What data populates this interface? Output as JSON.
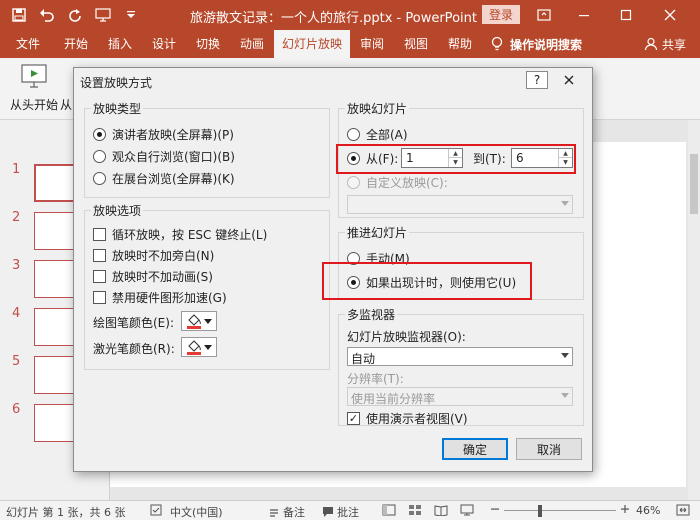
{
  "colors": {
    "accent": "#b7472a",
    "highlight": "#e0191c",
    "pen": "#e53935"
  },
  "window": {
    "title": "旅游散文记录：一个人的旅行.pptx  -  PowerPoint",
    "login": "登录"
  },
  "ribbon": {
    "tabs": [
      "文件",
      "开始",
      "插入",
      "设计",
      "切换",
      "动画",
      "幻灯片放映",
      "审阅",
      "视图",
      "帮助"
    ],
    "active_tab": "幻灯片放映",
    "tell_me": "操作说明搜索",
    "share": "共享",
    "from_beginning": "从头开始",
    "from_current": "从"
  },
  "thumbnails": [
    "1",
    "2",
    "3",
    "4",
    "5",
    "6"
  ],
  "dialog": {
    "title": "设置放映方式",
    "help": "?",
    "show_type": {
      "label": "放映类型",
      "options": [
        "演讲者放映(全屏幕)(P)",
        "观众自行浏览(窗口)(B)",
        "在展台浏览(全屏幕)(K)"
      ],
      "selected_index": 0
    },
    "show_options": {
      "label": "放映选项",
      "checks": [
        "循环放映，按 ESC 键终止(L)",
        "放映时不加旁白(N)",
        "放映时不加动画(S)",
        "禁用硬件图形加速(G)"
      ],
      "pen_color_label": "绘图笔颜色(E):",
      "laser_color_label": "激光笔颜色(R):"
    },
    "show_slides": {
      "label": "放映幻灯片",
      "all": "全部(A)",
      "from": "从(F):",
      "from_value": "1",
      "to": "到(T):",
      "to_value": "6",
      "custom": "自定义放映(C):"
    },
    "advance": {
      "label": "推进幻灯片",
      "manual": "手动(M)",
      "timings": "如果出现计时，则使用它(U)"
    },
    "monitors": {
      "label": "多监视器",
      "monitor_label": "幻灯片放映监视器(O):",
      "monitor_value": "自动",
      "resolution_label": "分辨率(T):",
      "resolution_value": "使用当前分辨率",
      "presenter_view": "使用演示者视图(V)"
    },
    "ok": "确定",
    "cancel": "取消"
  },
  "status": {
    "slide_info": "幻灯片 第 1 张，共 6 张",
    "language": "中文(中国)",
    "notes": "备注",
    "comments": "批注",
    "zoom": "46%"
  }
}
